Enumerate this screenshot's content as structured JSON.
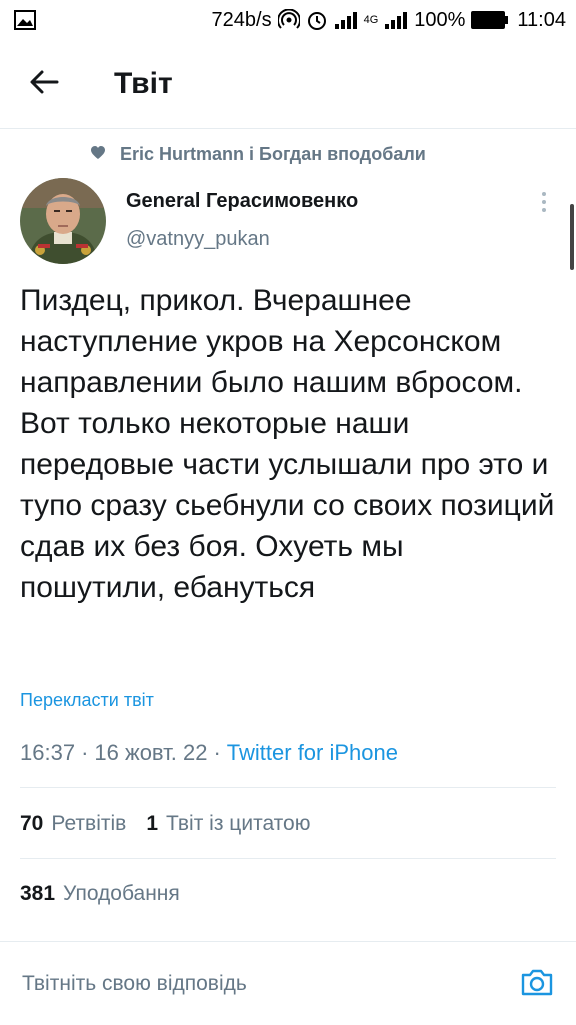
{
  "status_bar": {
    "speed": "724b/s",
    "battery": "100%",
    "time": "11:04",
    "network": "4G"
  },
  "header": {
    "title": "Твіт"
  },
  "tweet": {
    "social_context": "Eric Hurtmann і Богдан вподобали",
    "author_name": "General Герасимовенко",
    "author_handle": "@vatnyy_pukan",
    "text": "Пиздец, прикол. Вчерашнее наступление укров на Херсонском направлении было нашим вбросом. Вот только некоторые наши передовые части услышали про это и тупо сразу сьебнули со своих позиций сдав их без боя. Охуеть мы пошутили, ебануться",
    "translate_label": "Перекласти твіт",
    "time": "16:37",
    "date": "16 жовт. 22",
    "source": "Twitter for iPhone",
    "separator": "·"
  },
  "stats": {
    "retweets_count": "70",
    "retweets_label": "Ретвітів",
    "quotes_count": "1",
    "quotes_label": "Твіт із цитатою",
    "likes_count": "381",
    "likes_label": "Уподобання"
  },
  "reply": {
    "placeholder": "Твітніть свою відповідь"
  },
  "colors": {
    "accent": "#1b95e0",
    "secondary_text": "#657786",
    "divider": "#e6ecf0"
  }
}
